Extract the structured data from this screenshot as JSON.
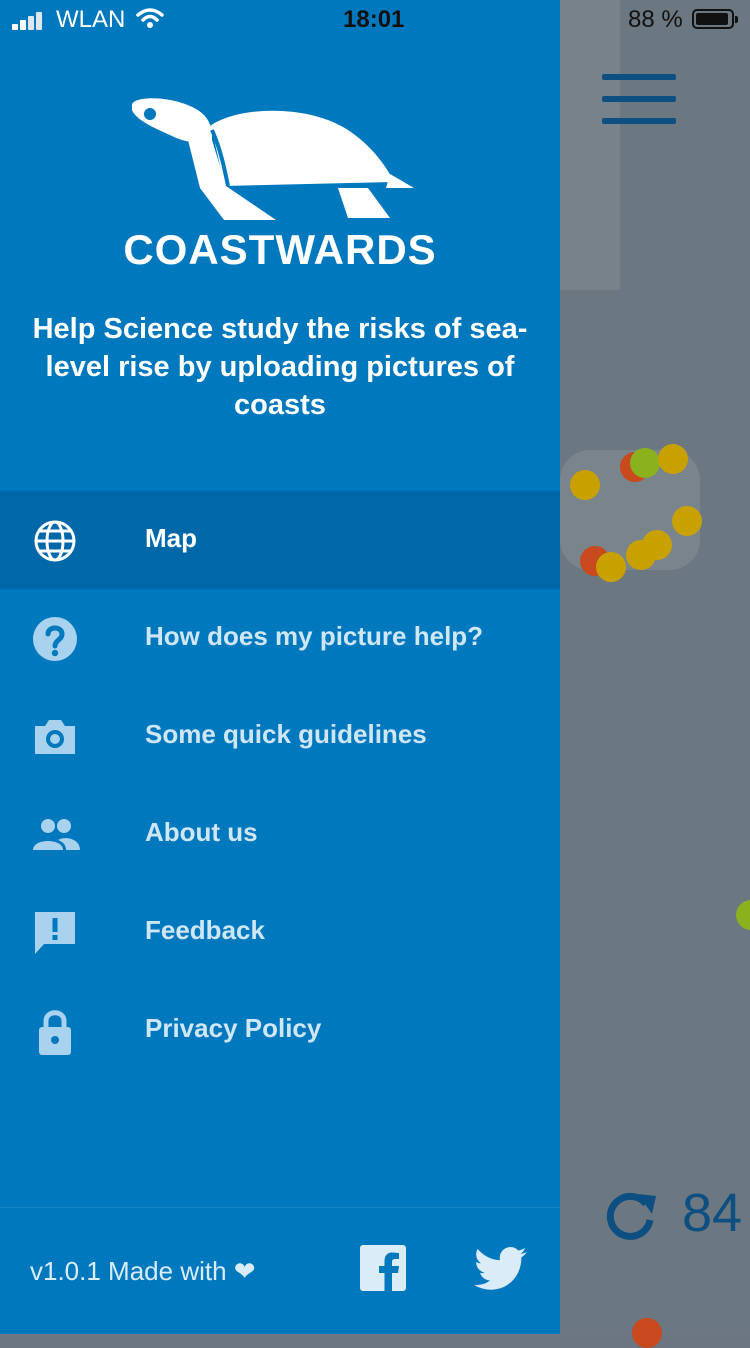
{
  "status_bar": {
    "carrier": "WLAN",
    "time": "18:01",
    "battery_percent": "88 %",
    "signal_icon": "signal-bars-icon",
    "wifi_icon": "wifi-icon",
    "battery_icon": "battery-icon"
  },
  "drawer": {
    "brand": "COASTWARDS",
    "logo_icon": "turtle-logo-icon",
    "tagline": "Help Science study the risks of sea-level rise by uploading pictures of coasts",
    "items": [
      {
        "label": "Map",
        "icon": "globe-icon",
        "active": true
      },
      {
        "label": "How does my picture help?",
        "icon": "help-circle-icon",
        "active": false
      },
      {
        "label": "Some quick guidelines",
        "icon": "camera-icon",
        "active": false
      },
      {
        "label": "About us",
        "icon": "people-icon",
        "active": false
      },
      {
        "label": "Feedback",
        "icon": "feedback-icon",
        "active": false
      },
      {
        "label": "Privacy Policy",
        "icon": "lock-icon",
        "active": false
      }
    ],
    "footer": {
      "text": "v1.0.1 Made with ❤",
      "facebook_icon": "facebook-icon",
      "twitter_icon": "twitter-icon"
    }
  },
  "map": {
    "menu_icon": "hamburger-menu-icon",
    "refresh_icon": "refresh-icon",
    "refresh_count": "84"
  },
  "colors": {
    "drawer_bg": "#0078be",
    "drawer_active_bg": "#0068a8",
    "map_overlay": "#6b7781",
    "map_accent": "#0d4f80"
  }
}
